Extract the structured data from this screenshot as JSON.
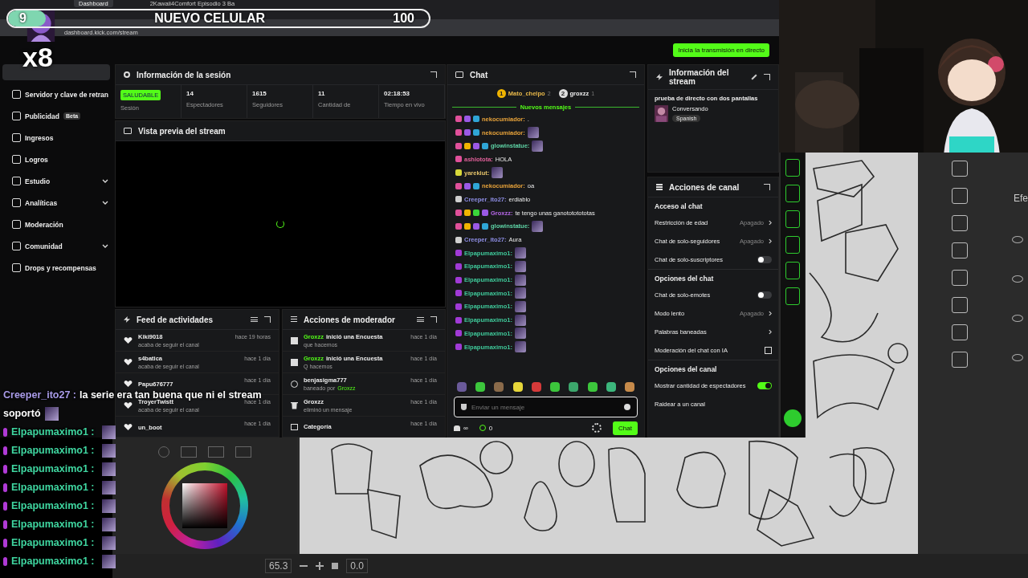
{
  "goal_bar": {
    "count": "9",
    "title": "NUEVO CELULAR",
    "target": "100",
    "level": 0.09,
    "multiplier": "x8"
  },
  "browser": {
    "tabs": [
      {
        "label": "Dashboard",
        "selected": true
      },
      {
        "label": "2Kawaii4Comfort Episodio 3 Ba",
        "selected": false
      }
    ],
    "url": "dashboard.kick.com/stream",
    "go_live_button": "Inicia la transmisión en directo"
  },
  "sidebar": {
    "items": [
      {
        "label": "Servidor y clave de retran",
        "expandable": false
      },
      {
        "label": "Publicidad",
        "badge": "Beta",
        "expandable": false
      },
      {
        "label": "Ingresos",
        "expandable": false
      },
      {
        "label": "Logros",
        "expandable": false
      },
      {
        "label": "Estudio",
        "expandable": true
      },
      {
        "label": "Analíticas",
        "expandable": true
      },
      {
        "label": "Moderación",
        "expandable": false
      },
      {
        "label": "Comunidad",
        "expandable": true
      },
      {
        "label": "Drops y recompensas",
        "expandable": false
      }
    ]
  },
  "session": {
    "title": "Información de la sesión",
    "status": "SALUDABLE",
    "status_label": "Sesión",
    "stats": [
      {
        "value": "14",
        "label": "Espectadores"
      },
      {
        "value": "1615",
        "label": "Seguidores"
      },
      {
        "value": "11",
        "label": "Cantidad de"
      },
      {
        "value": "02:18:53",
        "label": "Tiempo en vivo"
      }
    ]
  },
  "preview": {
    "title": "Vista previa del stream"
  },
  "activity_feed": {
    "title": "Feed de actividades",
    "items": [
      {
        "user": "Kiki9018",
        "detail": "acaba de seguir el canal",
        "time": "hace 19 horas"
      },
      {
        "user": "s4batica",
        "detail": "acaba de seguir el canal",
        "time": "hace 1 día"
      },
      {
        "user": "Papu676777",
        "time": "hace 1 día"
      },
      {
        "user": "TroyerTwistt",
        "detail": "acaba de seguir el canal",
        "time": "hace 1 día"
      },
      {
        "user": "un_boot",
        "time": "hace 1 día"
      }
    ]
  },
  "moderator_actions": {
    "title": "Acciones de moderador",
    "items": [
      {
        "kind": "poll",
        "actor": "Groxzz",
        "text": "inició una Encuesta",
        "detail": "que hacemos",
        "time": "hace 1 día"
      },
      {
        "kind": "poll",
        "actor": "Groxzz",
        "text": "inició una Encuesta",
        "detail": "Q hacemos",
        "time": "hace 1 día"
      },
      {
        "kind": "ban",
        "text": "benjasigma777",
        "detail": "baneado por",
        "detail_user": "Groxzz",
        "time": "hace 1 día"
      },
      {
        "kind": "delete",
        "text": "Groxzz",
        "detail": "eliminó un mensaje",
        "time": "hace 1 día"
      },
      {
        "kind": "category",
        "text": "Categoría",
        "time": "hace 1 día"
      }
    ]
  },
  "chat": {
    "title": "Chat",
    "leaders": [
      {
        "rank": "1",
        "name": "Mato_chelpo",
        "count": "2"
      },
      {
        "rank": "2",
        "name": "groxzz",
        "count": "1"
      }
    ],
    "divider": "Nuevos mensajes",
    "messages": [
      {
        "badges": [
          {
            "color": "#e0509a"
          },
          {
            "color": "#9b59e6"
          },
          {
            "color": "#2fa6d6"
          }
        ],
        "user": "nekocumiador:",
        "color": "#e8a33a",
        "text": "."
      },
      {
        "badges": [
          {
            "color": "#e0509a"
          },
          {
            "color": "#9b59e6"
          },
          {
            "color": "#2fa6d6"
          }
        ],
        "user": "nekocumiador:",
        "color": "#e8a33a",
        "emote": true
      },
      {
        "badges": [
          {
            "color": "#e0509a"
          },
          {
            "color": "#f0b400"
          },
          {
            "color": "#9b59e6"
          },
          {
            "color": "#2fa6d6"
          }
        ],
        "user": "glowinstatue:",
        "color": "#5fd6a8",
        "emote": true
      },
      {
        "badges": [
          {
            "color": "#e0509a"
          }
        ],
        "user": "ashlotota:",
        "color": "#e0609a",
        "text": "HOLA"
      },
      {
        "badges": [
          {
            "color": "#d8d83a"
          }
        ],
        "user": "yarekiut:",
        "color": "#e6c46a",
        "emote": true
      },
      {
        "badges": [
          {
            "color": "#e0509a"
          },
          {
            "color": "#9b59e6"
          },
          {
            "color": "#2fa6d6"
          }
        ],
        "user": "nekocumiador:",
        "color": "#e8a33a",
        "text": "oa"
      },
      {
        "badges": [
          {
            "color": "#cfcfcf"
          }
        ],
        "user": "Creeper_ito27:",
        "color": "#8f8fe6",
        "text": "erdiablo"
      },
      {
        "badges": [
          {
            "color": "#e0509a"
          },
          {
            "color": "#f0b400"
          },
          {
            "color": "#3ad63a"
          },
          {
            "color": "#9b59e6"
          }
        ],
        "user": "Groxzz:",
        "color": "#b566e6",
        "text": "te tengo unas ganotototototas"
      },
      {
        "badges": [
          {
            "color": "#e0509a"
          },
          {
            "color": "#f0b400"
          },
          {
            "color": "#9b59e6"
          },
          {
            "color": "#2fa6d6"
          }
        ],
        "user": "glowinstatue:",
        "color": "#5fd6a8",
        "emote": true
      },
      {
        "badges": [
          {
            "color": "#cfcfcf"
          }
        ],
        "user": "Creeper_ito27:",
        "color": "#8f8fe6",
        "text": "Aura"
      },
      {
        "badges": [
          {
            "color": "#a03ad6"
          }
        ],
        "user": "Elpapumaximo1:",
        "color": "#3fc99a",
        "emote": true
      },
      {
        "badges": [
          {
            "color": "#a03ad6"
          }
        ],
        "user": "Elpapumaximo1:",
        "color": "#3fc99a",
        "emote": true
      },
      {
        "badges": [
          {
            "color": "#a03ad6"
          }
        ],
        "user": "Elpapumaximo1:",
        "color": "#3fc99a",
        "emote": true
      },
      {
        "badges": [
          {
            "color": "#a03ad6"
          }
        ],
        "user": "Elpapumaximo1:",
        "color": "#3fc99a",
        "emote": true
      },
      {
        "badges": [
          {
            "color": "#a03ad6"
          }
        ],
        "user": "Elpapumaximo1:",
        "color": "#3fc99a",
        "emote": true
      },
      {
        "badges": [
          {
            "color": "#a03ad6"
          }
        ],
        "user": "Elpapumaximo1:",
        "color": "#3fc99a",
        "emote": true
      },
      {
        "badges": [
          {
            "color": "#a03ad6"
          }
        ],
        "user": "Elpapumaximo1:",
        "color": "#3fc99a",
        "emote": true
      },
      {
        "badges": [
          {
            "color": "#a03ad6"
          }
        ],
        "user": "Elpapumaximo1:",
        "color": "#3fc99a",
        "emote": true
      }
    ],
    "placeholder": "Enviar un mensaje",
    "footer_count": "∞",
    "points": "0",
    "send_button": "Chat"
  },
  "stream_info": {
    "title": "Información del stream",
    "stream_title": "prueba de directo con dos pantallas",
    "category": "Conversando",
    "tag": "Spanish"
  },
  "channel_actions": {
    "title": "Acciones de canal",
    "sections": [
      {
        "title": "Acceso al chat",
        "rows": [
          {
            "kind": "link",
            "label": "Restricción de edad",
            "value": "Apagado"
          },
          {
            "kind": "link",
            "label": "Chat de solo-seguidores",
            "value": "Apagado"
          },
          {
            "kind": "toggle",
            "label": "Chat de solo-suscriptores",
            "on": false
          }
        ]
      },
      {
        "title": "Opciones del chat",
        "rows": [
          {
            "kind": "toggle",
            "label": "Chat de solo-emotes",
            "on": false
          },
          {
            "kind": "link",
            "label": "Modo lento",
            "value": "Apagado"
          },
          {
            "kind": "link",
            "label": "Palabras baneadas"
          },
          {
            "kind": "external",
            "label": "Moderación del chat con IA"
          }
        ]
      },
      {
        "title": "Opciones del canal",
        "rows": [
          {
            "kind": "toggle",
            "label": "Mostrar cantidad de espectadores",
            "on": true
          },
          {
            "kind": "plain",
            "label": "Raidear a un canal"
          }
        ]
      }
    ]
  },
  "stream_chat_overlay": [
    {
      "user": "Creeper_ito27 :",
      "color": "#a99be8",
      "lines": [
        "la serie era tan buena que ni el stream",
        "soportó"
      ],
      "emote": true
    },
    {
      "user": "Elpapumaximo1 :",
      "color": "#3fd6a0",
      "badge": true,
      "emote": true
    },
    {
      "user": "Elpapumaximo1 :",
      "color": "#3fd6a0",
      "badge": true,
      "emote": true
    },
    {
      "user": "Elpapumaximo1 :",
      "color": "#3fd6a0",
      "badge": true,
      "emote": true
    },
    {
      "user": "Elpapumaximo1 :",
      "color": "#3fd6a0",
      "badge": true,
      "emote": true
    },
    {
      "user": "Elpapumaximo1 :",
      "color": "#3fd6a0",
      "badge": true,
      "emote": true
    },
    {
      "user": "Elpapumaximo1 :",
      "color": "#3fd6a0",
      "badge": true,
      "emote": true
    },
    {
      "user": "Elpapumaximo1 :",
      "color": "#3fd6a0",
      "badge": true,
      "emote": true
    },
    {
      "user": "Elpapumaximo1 :",
      "color": "#3fd6a0",
      "badge": true,
      "emote": true
    }
  ],
  "paint_app": {
    "side_label": "Efe",
    "zoom_value": "65.3",
    "rotation_value": "0.0"
  }
}
